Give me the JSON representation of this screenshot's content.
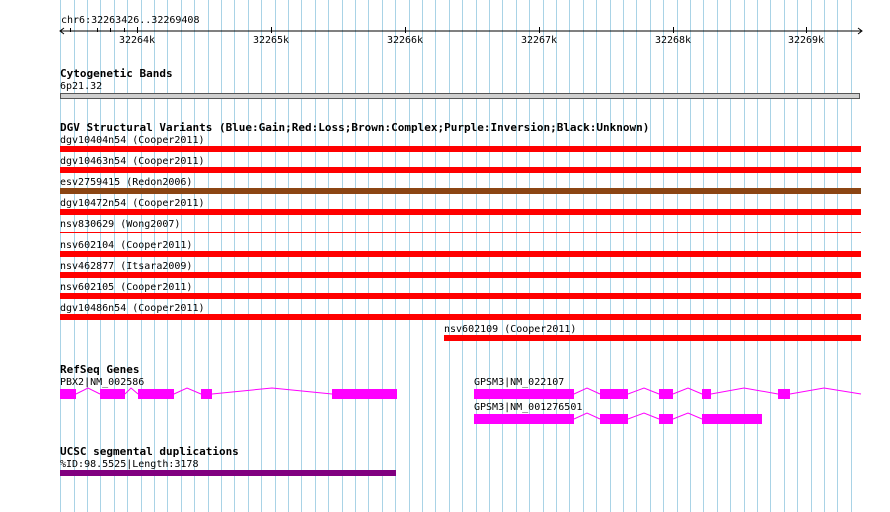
{
  "ruler": {
    "coordinate": "chr6:32263426..32269408",
    "ticks": [
      "32264k",
      "32265k",
      "32266k",
      "32267k",
      "32268k",
      "32269k"
    ]
  },
  "cytobands": {
    "title": "Cytogenetic Bands",
    "band": "6p21.32"
  },
  "dgv": {
    "title": "DGV Structural Variants (Blue:Gain;Red:Loss;Brown:Complex;Purple:Inversion;Black:Unknown)",
    "variants": [
      {
        "label": "dgv10404n54 (Cooper2011)",
        "color": "#ff0000"
      },
      {
        "label": "dgv10463n54 (Cooper2011)",
        "color": "#ff0000"
      },
      {
        "label": "esv2759415 (Redon2006)",
        "color": "#8b4513"
      },
      {
        "label": "dgv10472n54 (Cooper2011)",
        "color": "#ff0000"
      },
      {
        "label": "nsv830629 (Wong2007)",
        "color": "#ff0000"
      },
      {
        "label": "nsv602104 (Cooper2011)",
        "color": "#ff0000"
      },
      {
        "label": "nsv462877 (Itsara2009)",
        "color": "#ff0000"
      },
      {
        "label": "nsv602105 (Cooper2011)",
        "color": "#ff0000"
      },
      {
        "label": "dgv10486n54 (Cooper2011)",
        "color": "#ff0000"
      },
      {
        "label": "nsv602109 (Cooper2011)",
        "color": "#ff0000"
      }
    ]
  },
  "refseq": {
    "title": "RefSeq Genes",
    "genes": [
      {
        "label": "PBX2|NM_002586"
      },
      {
        "label": "GPSM3|NM_022107"
      },
      {
        "label": "GPSM3|NM_001276501"
      }
    ],
    "exon_color": "#ff00ff"
  },
  "segdups": {
    "title": "UCSC segmental duplications",
    "label": "%ID:98.5525|Length:3178",
    "color": "#800080"
  }
}
